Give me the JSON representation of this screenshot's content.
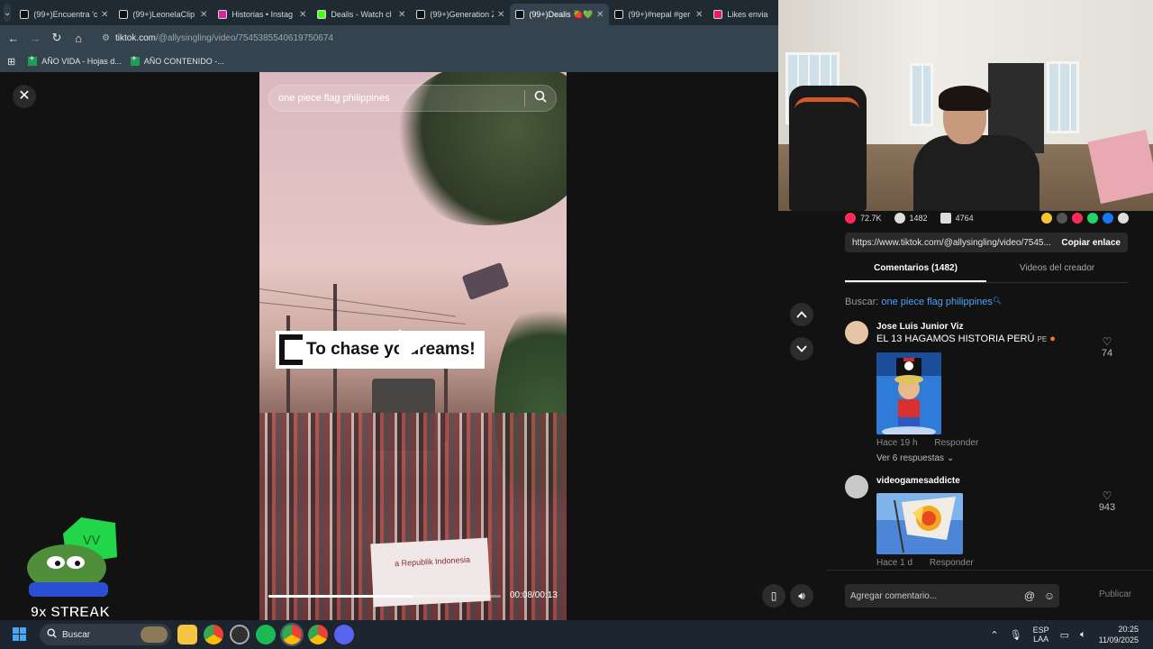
{
  "browser": {
    "tabs": [
      {
        "label": "(99+)Encuentra 'c",
        "color": "#111111",
        "active": false
      },
      {
        "label": "(99+)LeonelaClip",
        "color": "#111111",
        "active": false
      },
      {
        "label": "Historias • Instag",
        "color": "#d6249f",
        "active": false
      },
      {
        "label": "Dealis - Watch cl",
        "color": "#53fc18",
        "active": false
      },
      {
        "label": "(99+)Generation Z",
        "color": "#111111",
        "active": false
      },
      {
        "label": "(99+)Dealis 🍓💚",
        "color": "#111111",
        "active": true
      },
      {
        "label": "(99+)#nepal #ger",
        "color": "#111111",
        "active": false
      },
      {
        "label": "Likes envia",
        "color": "#e91e63",
        "active": false
      }
    ],
    "url_host": "tiktok.com",
    "url_path": "/@allysingling/video/7545385540619750674",
    "bookmarks": [
      "AÑO VIDA - Hojas d...",
      "AÑO CONTENIDO -..."
    ]
  },
  "video": {
    "search_value": "one piece flag philippines",
    "caption": "To chase yo  dreams!",
    "banner_text": "a Republik Indonesia",
    "time": "00:08/00:13",
    "progress": 0.62
  },
  "overlay": {
    "streak": "9x STREAK"
  },
  "panel": {
    "actions": [
      {
        "icon": "heart-icon",
        "count": "72.7K",
        "color": "#fe2c55"
      },
      {
        "icon": "comment-icon",
        "count": "1482",
        "color": "#dddddd"
      },
      {
        "icon": "bookmark-icon",
        "count": "4764",
        "color": "#dddddd"
      }
    ],
    "share_icons": [
      "#f7c531",
      "#555555",
      "#fe2c55",
      "#25d366",
      "#1877f2",
      "#dddddd"
    ],
    "share_url": "https://www.tiktok.com/@allysingling/video/7545...",
    "copy_link": "Copiar enlace",
    "tab_comments": "Comentarios (1482)",
    "tab_videos": "Videos del creador",
    "search_prefix": "Buscar:",
    "search_query": "one piece flag philippines",
    "comments": [
      {
        "user": "Jose Luis Junior Viz",
        "text": "EL 13 HAGAMOS HISTORIA PERÚ",
        "flag": "PE",
        "time": "Hace 19 h",
        "reply": "Responder",
        "replies": "Ver 6 respuestas",
        "likes": "74"
      },
      {
        "user": "videogamesaddicte",
        "time": "Hace 1 d",
        "reply": "Responder",
        "likes": "943"
      }
    ],
    "comment_placeholder": "Agregar comentario...",
    "publish": "Publicar"
  },
  "taskbar": {
    "search": "Buscar",
    "lang_top": "ESP",
    "lang_bottom": "LAA",
    "time": "20:25",
    "date": "11/09/2025"
  }
}
